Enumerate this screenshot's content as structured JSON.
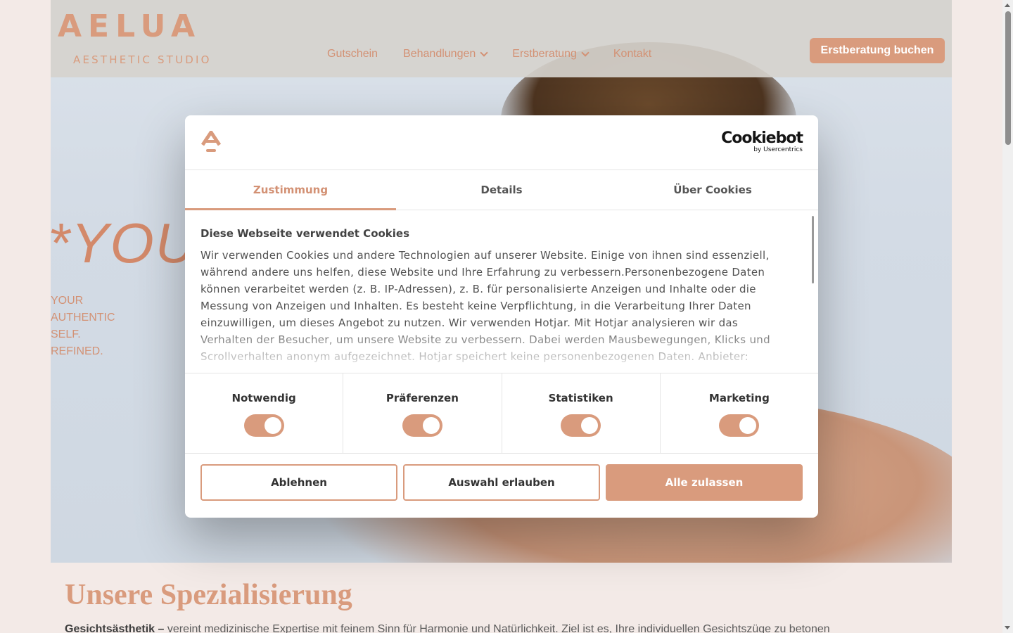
{
  "site": {
    "logo_main": "AELUA",
    "logo_sub": "AESTHETIC STUDIO",
    "nav": [
      {
        "label": "Gutschein",
        "dropdown": false
      },
      {
        "label": "Behandlungen",
        "dropdown": true
      },
      {
        "label": "Erstberatung",
        "dropdown": true
      },
      {
        "label": "Kontakt",
        "dropdown": false
      }
    ],
    "cta_label": "Erstberatung buchen",
    "hero_title": "*YOU",
    "hero_tagline": [
      "YOUR",
      "AUTHENTIC",
      "SELF.",
      "REFINED."
    ],
    "section_title": "Unsere Spezialisierung",
    "section_text_bold": "Gesichtsästhetik –",
    "section_text": " vereint medizinische Expertise mit feinem Sinn für Harmonie und Natürlichkeit. Ziel ist es, Ihre individuellen Gesichtszüge zu betonen"
  },
  "dialog": {
    "brand": "Cookiebot",
    "brand_sub": "by Usercentrics",
    "tabs": [
      {
        "label": "Zustimmung",
        "active": true
      },
      {
        "label": "Details",
        "active": false
      },
      {
        "label": "Über Cookies",
        "active": false
      }
    ],
    "title": "Diese Webseite verwendet Cookies",
    "text": "Wir verwenden Cookies und andere Technologien auf unserer Website. Einige von ihnen sind essenziell, während andere uns helfen, diese Website und Ihre Erfahrung zu verbessern.Personenbezogene Daten können verarbeitet werden (z. B. IP-Adressen), z. B. für personalisierte Anzeigen und Inhalte oder die Messung von Anzeigen und Inhalten. Es besteht keine Verpflichtung, in die Verarbeitung Ihrer Daten einzuwilligen, um dieses Angebot zu nutzen. Wir verwenden Hotjar. Mit Hotjar analysieren wir das Verhalten der Besucher, um unsere Website zu verbessern. Dabei werden Mausbewegungen, Klicks und Scrollverhalten anonym aufgezeichnet. Hotjar speichert keine personenbezogenen Daten. Anbieter:",
    "toggles": [
      {
        "label": "Notwendig",
        "on": true
      },
      {
        "label": "Präferenzen",
        "on": true
      },
      {
        "label": "Statistiken",
        "on": true
      },
      {
        "label": "Marketing",
        "on": true
      }
    ],
    "buttons": {
      "deny": "Ablehnen",
      "selection": "Auswahl erlauben",
      "allow_all": "Alle zulassen"
    }
  },
  "colors": {
    "accent": "#d99b7d",
    "page_bg": "#f3eae7"
  }
}
